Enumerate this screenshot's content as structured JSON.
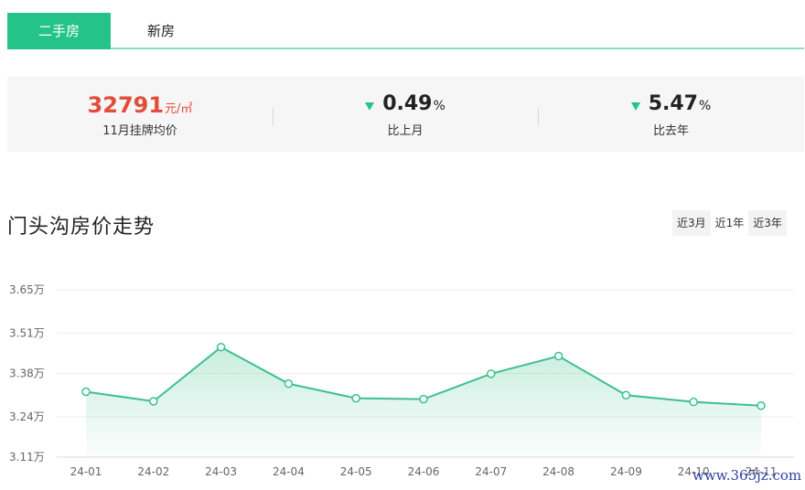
{
  "tabs": {
    "active_label": "二手房",
    "inactive_label": "新房"
  },
  "stats": {
    "price_value": "32791",
    "price_unit": "元/㎡",
    "price_label": "11月挂牌均价",
    "mom_value": "0.49",
    "mom_unit": "%",
    "mom_label": "比上月",
    "yoy_value": "5.47",
    "yoy_unit": "%",
    "yoy_label": "比去年",
    "trend_icon": "down-triangle-icon",
    "accent_color": "#24c38a",
    "price_color": "#e24c3b"
  },
  "chart_header": {
    "title": "门头沟房价走势",
    "ranges": [
      "近3月",
      "近1年",
      "近3年"
    ],
    "selected_range": "近1年"
  },
  "watermark": "www.365jz.com",
  "chart_data": {
    "type": "area",
    "categories": [
      "24-01",
      "24-02",
      "24-03",
      "24-04",
      "24-05",
      "24-06",
      "24-07",
      "24-08",
      "24-09",
      "24-10",
      "24-11"
    ],
    "values": [
      33210,
      32900,
      34650,
      33470,
      33000,
      32970,
      33790,
      34360,
      33100,
      32880,
      32760
    ],
    "y_ticks": [
      "3.65万",
      "3.51万",
      "3.38万",
      "3.24万",
      "3.11万"
    ],
    "y_tick_values": [
      36500,
      35100,
      33800,
      32400,
      31100
    ],
    "ylim": [
      31100,
      36500
    ],
    "grid": true,
    "line_color": "#3cc08e",
    "title": "",
    "xlabel": "",
    "ylabel": ""
  }
}
